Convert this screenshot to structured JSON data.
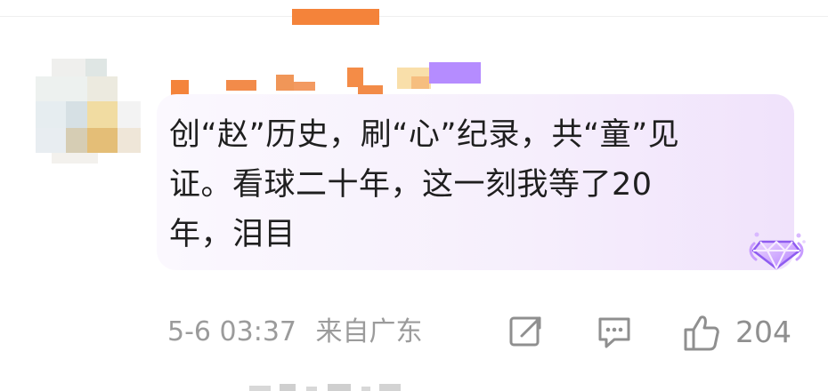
{
  "header": {
    "accent_color": "#f4833a"
  },
  "comment": {
    "text": "创“赵”历史，刷“心”纪录，共“童”见\n证。看球二十年，这一刻我等了20\n年，泪目",
    "timestamp": "5-6 03:37",
    "location": "来自广东",
    "like_count": "204",
    "bubble_color": "#f3ebfb"
  },
  "icons": {
    "share": "share-icon",
    "reply": "reply-icon",
    "like": "thumbs-up-icon",
    "badge": "purple-gem-badge-icon"
  }
}
